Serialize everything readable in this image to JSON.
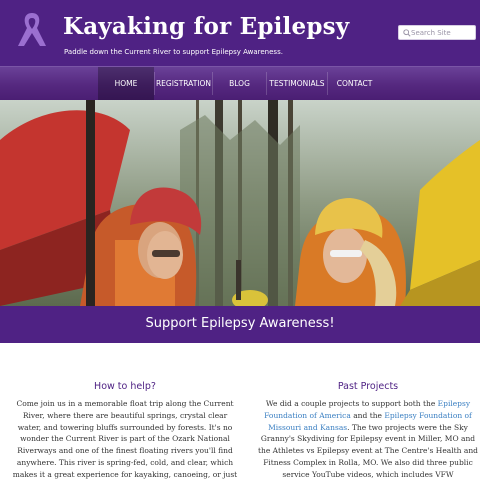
{
  "header": {
    "title": "Kayaking for Epilepsy",
    "tagline": "Paddle down the Current River to support Epilepsy Awareness.",
    "logo_icon": "awareness-ribbon-icon",
    "brand_color": "#4f2284"
  },
  "search": {
    "placeholder": "Search Site",
    "icon": "search-icon"
  },
  "nav": {
    "items": [
      {
        "label": "HOME",
        "active": true
      },
      {
        "label": "REGISTRATION",
        "active": false
      },
      {
        "label": "BLOG",
        "active": false
      },
      {
        "label": "TESTIMONIALS",
        "active": false
      },
      {
        "label": "CONTACT",
        "active": false
      }
    ]
  },
  "hero": {
    "image": "two-women-in-helmets-with-kayaks-photo"
  },
  "banner": {
    "text": "Support Epilepsy Awareness!"
  },
  "sections": {
    "how": {
      "heading": "How to help?",
      "body": "Come join us in a memorable float trip along the Current River, where there are beautiful springs, crystal clear water, and towering bluffs surrounded by forests. It's no wonder the Current River is part of the Ozark National Riverways and one of the finest floating rivers you'll find anywhere. This river is spring-fed, cold, and clear, which makes it a great experience for kayaking, canoeing, or just floating to relax. All profits from"
    },
    "past": {
      "heading": "Past Projects",
      "text_1": "We did a couple projects to support both the ",
      "link_1": "Epilepsy Foundation of America",
      "text_2": " and the ",
      "link_2": "Epilepsy Foundation of Missouri and Kansas",
      "text_3": ". The two projects were the Sky Granny's Skydiving for Epilepsy event in Miller, MO and the Athletes vs Epilepsy event at The Centre's Health and Fitness Complex in Rolla, MO. We also did three public service YouTube videos, which includes VFW"
    }
  },
  "colors": {
    "link": "#3a7fc2",
    "heading": "#4f2284",
    "nav_gradient_top": "#6a4198"
  }
}
